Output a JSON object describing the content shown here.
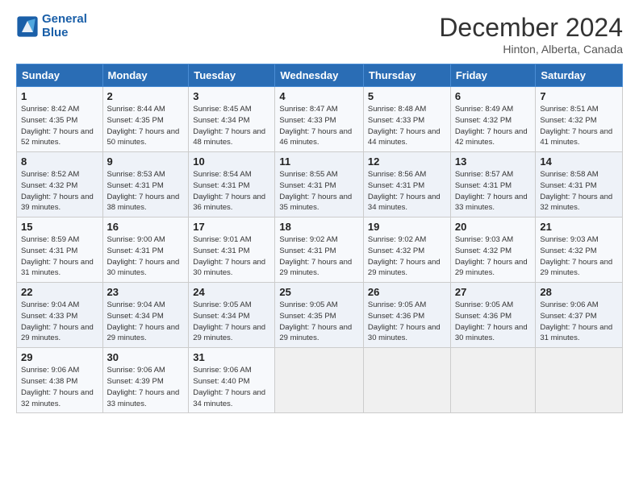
{
  "header": {
    "logo_line1": "General",
    "logo_line2": "Blue",
    "month": "December 2024",
    "location": "Hinton, Alberta, Canada"
  },
  "days_of_week": [
    "Sunday",
    "Monday",
    "Tuesday",
    "Wednesday",
    "Thursday",
    "Friday",
    "Saturday"
  ],
  "weeks": [
    [
      {
        "day": "1",
        "sunrise": "Sunrise: 8:42 AM",
        "sunset": "Sunset: 4:35 PM",
        "daylight": "Daylight: 7 hours and 52 minutes."
      },
      {
        "day": "2",
        "sunrise": "Sunrise: 8:44 AM",
        "sunset": "Sunset: 4:35 PM",
        "daylight": "Daylight: 7 hours and 50 minutes."
      },
      {
        "day": "3",
        "sunrise": "Sunrise: 8:45 AM",
        "sunset": "Sunset: 4:34 PM",
        "daylight": "Daylight: 7 hours and 48 minutes."
      },
      {
        "day": "4",
        "sunrise": "Sunrise: 8:47 AM",
        "sunset": "Sunset: 4:33 PM",
        "daylight": "Daylight: 7 hours and 46 minutes."
      },
      {
        "day": "5",
        "sunrise": "Sunrise: 8:48 AM",
        "sunset": "Sunset: 4:33 PM",
        "daylight": "Daylight: 7 hours and 44 minutes."
      },
      {
        "day": "6",
        "sunrise": "Sunrise: 8:49 AM",
        "sunset": "Sunset: 4:32 PM",
        "daylight": "Daylight: 7 hours and 42 minutes."
      },
      {
        "day": "7",
        "sunrise": "Sunrise: 8:51 AM",
        "sunset": "Sunset: 4:32 PM",
        "daylight": "Daylight: 7 hours and 41 minutes."
      }
    ],
    [
      {
        "day": "8",
        "sunrise": "Sunrise: 8:52 AM",
        "sunset": "Sunset: 4:32 PM",
        "daylight": "Daylight: 7 hours and 39 minutes."
      },
      {
        "day": "9",
        "sunrise": "Sunrise: 8:53 AM",
        "sunset": "Sunset: 4:31 PM",
        "daylight": "Daylight: 7 hours and 38 minutes."
      },
      {
        "day": "10",
        "sunrise": "Sunrise: 8:54 AM",
        "sunset": "Sunset: 4:31 PM",
        "daylight": "Daylight: 7 hours and 36 minutes."
      },
      {
        "day": "11",
        "sunrise": "Sunrise: 8:55 AM",
        "sunset": "Sunset: 4:31 PM",
        "daylight": "Daylight: 7 hours and 35 minutes."
      },
      {
        "day": "12",
        "sunrise": "Sunrise: 8:56 AM",
        "sunset": "Sunset: 4:31 PM",
        "daylight": "Daylight: 7 hours and 34 minutes."
      },
      {
        "day": "13",
        "sunrise": "Sunrise: 8:57 AM",
        "sunset": "Sunset: 4:31 PM",
        "daylight": "Daylight: 7 hours and 33 minutes."
      },
      {
        "day": "14",
        "sunrise": "Sunrise: 8:58 AM",
        "sunset": "Sunset: 4:31 PM",
        "daylight": "Daylight: 7 hours and 32 minutes."
      }
    ],
    [
      {
        "day": "15",
        "sunrise": "Sunrise: 8:59 AM",
        "sunset": "Sunset: 4:31 PM",
        "daylight": "Daylight: 7 hours and 31 minutes."
      },
      {
        "day": "16",
        "sunrise": "Sunrise: 9:00 AM",
        "sunset": "Sunset: 4:31 PM",
        "daylight": "Daylight: 7 hours and 30 minutes."
      },
      {
        "day": "17",
        "sunrise": "Sunrise: 9:01 AM",
        "sunset": "Sunset: 4:31 PM",
        "daylight": "Daylight: 7 hours and 30 minutes."
      },
      {
        "day": "18",
        "sunrise": "Sunrise: 9:02 AM",
        "sunset": "Sunset: 4:31 PM",
        "daylight": "Daylight: 7 hours and 29 minutes."
      },
      {
        "day": "19",
        "sunrise": "Sunrise: 9:02 AM",
        "sunset": "Sunset: 4:32 PM",
        "daylight": "Daylight: 7 hours and 29 minutes."
      },
      {
        "day": "20",
        "sunrise": "Sunrise: 9:03 AM",
        "sunset": "Sunset: 4:32 PM",
        "daylight": "Daylight: 7 hours and 29 minutes."
      },
      {
        "day": "21",
        "sunrise": "Sunrise: 9:03 AM",
        "sunset": "Sunset: 4:32 PM",
        "daylight": "Daylight: 7 hours and 29 minutes."
      }
    ],
    [
      {
        "day": "22",
        "sunrise": "Sunrise: 9:04 AM",
        "sunset": "Sunset: 4:33 PM",
        "daylight": "Daylight: 7 hours and 29 minutes."
      },
      {
        "day": "23",
        "sunrise": "Sunrise: 9:04 AM",
        "sunset": "Sunset: 4:34 PM",
        "daylight": "Daylight: 7 hours and 29 minutes."
      },
      {
        "day": "24",
        "sunrise": "Sunrise: 9:05 AM",
        "sunset": "Sunset: 4:34 PM",
        "daylight": "Daylight: 7 hours and 29 minutes."
      },
      {
        "day": "25",
        "sunrise": "Sunrise: 9:05 AM",
        "sunset": "Sunset: 4:35 PM",
        "daylight": "Daylight: 7 hours and 29 minutes."
      },
      {
        "day": "26",
        "sunrise": "Sunrise: 9:05 AM",
        "sunset": "Sunset: 4:36 PM",
        "daylight": "Daylight: 7 hours and 30 minutes."
      },
      {
        "day": "27",
        "sunrise": "Sunrise: 9:05 AM",
        "sunset": "Sunset: 4:36 PM",
        "daylight": "Daylight: 7 hours and 30 minutes."
      },
      {
        "day": "28",
        "sunrise": "Sunrise: 9:06 AM",
        "sunset": "Sunset: 4:37 PM",
        "daylight": "Daylight: 7 hours and 31 minutes."
      }
    ],
    [
      {
        "day": "29",
        "sunrise": "Sunrise: 9:06 AM",
        "sunset": "Sunset: 4:38 PM",
        "daylight": "Daylight: 7 hours and 32 minutes."
      },
      {
        "day": "30",
        "sunrise": "Sunrise: 9:06 AM",
        "sunset": "Sunset: 4:39 PM",
        "daylight": "Daylight: 7 hours and 33 minutes."
      },
      {
        "day": "31",
        "sunrise": "Sunrise: 9:06 AM",
        "sunset": "Sunset: 4:40 PM",
        "daylight": "Daylight: 7 hours and 34 minutes."
      },
      null,
      null,
      null,
      null
    ]
  ]
}
